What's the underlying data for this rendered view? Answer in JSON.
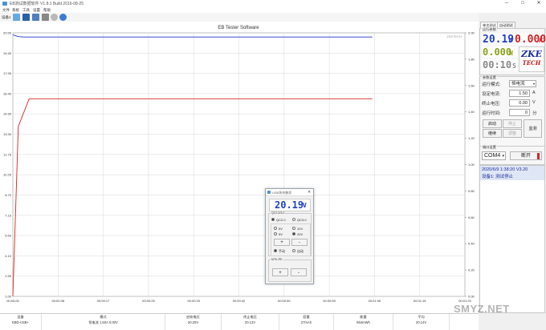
{
  "window": {
    "title": "EB测试数据软件 V1.8.1 Build 2016-08-25",
    "minimize": "─",
    "maximize": "□",
    "close": "✕"
  },
  "menu": [
    "文件",
    "系统",
    "工具",
    "设置",
    "帮助"
  ],
  "toolbar": {
    "device_label": "设备1",
    "icons": [
      "open-icon",
      "save-icon",
      "print-icon",
      "tools-icon",
      "zoom-icon",
      "info-icon"
    ]
  },
  "chart": {
    "title": "EB Tester Software",
    "brand": "ZKETECH",
    "left_ticks": [
      "20.50",
      "19.45",
      "17.95",
      "16.40",
      "14.85",
      "13.30",
      "11.75",
      "10.25",
      "8.70",
      "7.15",
      "5.60",
      "4.10",
      "2.55",
      "1.00"
    ],
    "right_ticks": [
      "2.00",
      "1.80",
      "1.60",
      "1.40",
      "1.20",
      "1.00",
      "0.80",
      "0.60",
      "0.40",
      "0.20",
      "0.00"
    ],
    "x_ticks": [
      "00:00:00",
      "00:00:08",
      "00:00:17",
      "00:00:25",
      "00:00:33",
      "00:00:42",
      "00:00:50",
      "00:00:59",
      "00:01:06",
      "00:01:15",
      "00:01:23"
    ],
    "colors": {
      "voltage": "#2233cc",
      "current": "#dd2222",
      "grid": "#d8d8d8"
    }
  },
  "chart_data": {
    "type": "line",
    "title": "EB Tester Software",
    "xlabel": "",
    "ylabel": "",
    "x_unit": "seconds",
    "x_ticks": [
      "00:00:00",
      "00:00:08",
      "00:00:17",
      "00:00:25",
      "00:00:33",
      "00:00:42",
      "00:00:50",
      "00:00:59",
      "00:01:06",
      "00:01:15",
      "00:01:23"
    ],
    "series": [
      {
        "axis": "left",
        "color": "#2233cc",
        "x": [
          0,
          1,
          2,
          66
        ],
        "y": [
          20.35,
          20.22,
          20.19,
          20.19
        ]
      },
      {
        "axis": "right",
        "color": "#dd2222",
        "x": [
          0,
          1,
          3,
          66
        ],
        "y": [
          0.0,
          1.29,
          1.5,
          1.5
        ]
      }
    ],
    "left_ylim": [
      1.0,
      20.5
    ],
    "right_ylim": [
      0.0,
      2.0
    ],
    "xlim": [
      0,
      83
    ],
    "grid": true
  },
  "right_panel": {
    "tabs": [
      "单次测试",
      "自动测试"
    ],
    "run_params_label": "运行参数",
    "voltage_display": "20.19",
    "voltage_unit": "V",
    "current_display": "0.000",
    "current_unit": "A",
    "power_display": "0.000",
    "power_unit": "W",
    "time_display": "00:10",
    "time_unit": "S",
    "logo_top": "ZKE",
    "logo_bottom": "TECH",
    "settings_label": "参数设置",
    "mode_label": "运行模式:",
    "mode_value": "恒电流",
    "set_current_label": "设定电流:",
    "set_current_value": "1.50",
    "set_current_unit": "A",
    "stop_voltage_label": "终止电压:",
    "stop_voltage_value": "0.00",
    "stop_voltage_unit": "V",
    "run_time_label": "运行时间:",
    "run_time_value": "0",
    "run_time_unit": "分",
    "btn_start": "启动",
    "btn_stop": "停止",
    "btn_continue": "继续",
    "btn_adjust": "调整",
    "btn_monitor": "监测",
    "port_label": "端口设置",
    "port_value": "COM4",
    "btn_disconnect": "断开",
    "log_line1": "2020/6/9 1:38:20 V3.20",
    "log_line2": "设备1: 测试停止"
  },
  "dialog": {
    "title": "USB快充触发",
    "voltage_display": "20.19",
    "voltage_unit": "V",
    "section_qc": "QC2.0/3.0",
    "qc20": "QC2.0",
    "qc30": "QC3.0",
    "v5": "5V",
    "v12": "12V",
    "v9": "9V",
    "v20": "20V",
    "plus": "+",
    "minus": "-",
    "manual": "手动",
    "auto": "自动",
    "section_mtk": "MTK-PE",
    "plus2": "+",
    "minus2": "-"
  },
  "statusbar": {
    "headers": [
      "设备",
      "模式",
      "启始电压",
      "终止电压",
      "容量",
      "能量",
      "平均"
    ],
    "values": [
      "EBD-USB+",
      "恒电流 1.50A 0.00V",
      "20.20V",
      "20.13V",
      "27mAh",
      "564mWh",
      "20.14V"
    ]
  },
  "watermark": "SMYZ.NET"
}
